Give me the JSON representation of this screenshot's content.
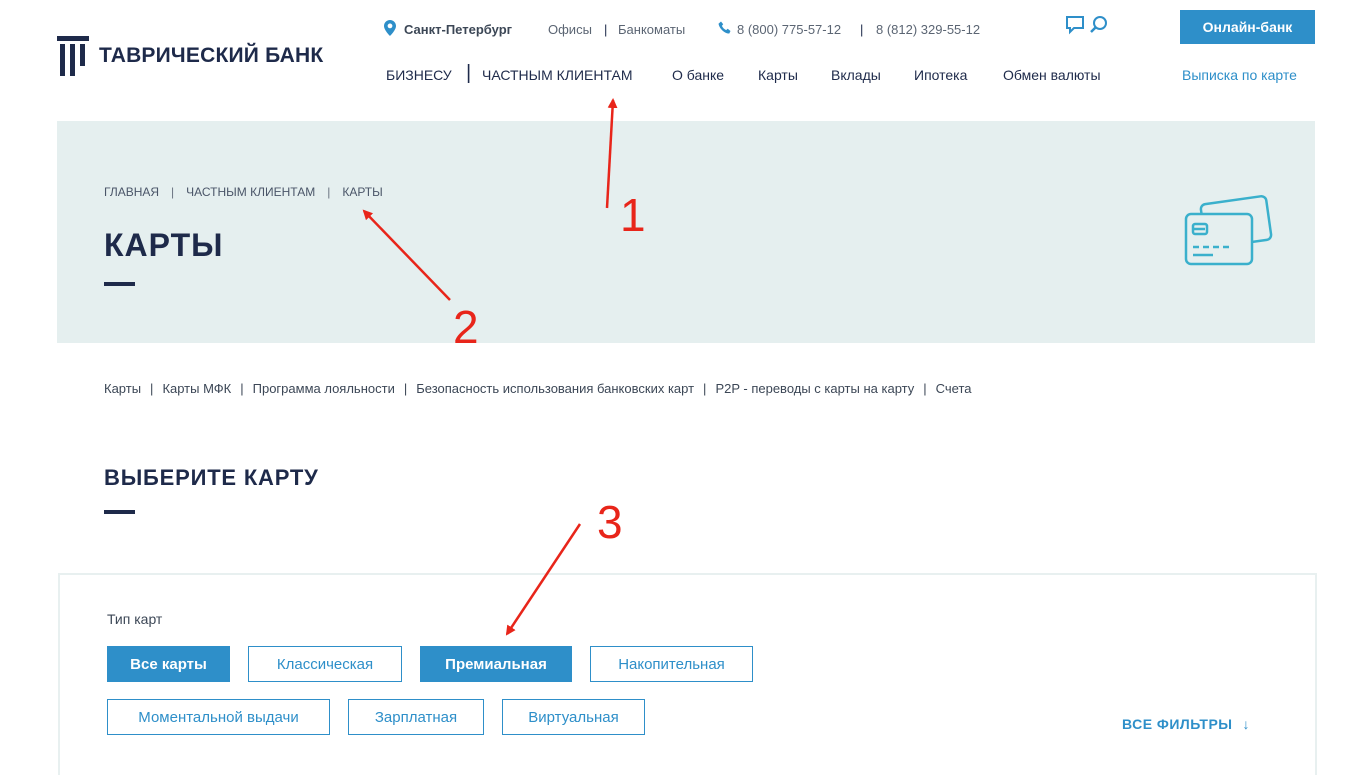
{
  "header": {
    "logo_text": "ТАВРИЧЕСКИЙ БАНК",
    "city": "Санкт-Петербург",
    "offices": "Офисы",
    "atms": "Банкоматы",
    "phone1": "8 (800) 775-57-12",
    "phone2": "8 (812) 329-55-12",
    "separator": "|",
    "online_bank": "Онлайн-банк",
    "icons": [
      "location-pin-icon",
      "phone-icon",
      "chat-icon",
      "search-icon"
    ]
  },
  "nav": {
    "business": "БИЗНЕСУ",
    "private": "ЧАСТНЫМ КЛИЕНТАМ",
    "items": [
      "О банке",
      "Карты",
      "Вклады",
      "Ипотека",
      "Обмен валюты"
    ],
    "statement": "Выписка по карте"
  },
  "banner": {
    "breadcrumbs": [
      "ГЛАВНАЯ",
      "ЧАСТНЫМ КЛИЕНТАМ",
      "КАРТЫ"
    ],
    "title": "КАРТЫ",
    "icon": "credit-cards-icon"
  },
  "subnav": [
    "Карты",
    "Карты МФК",
    "Программа лояльности",
    "Безопасность использования банковских карт",
    "P2P - переводы с карты на карту",
    "Счета"
  ],
  "select": {
    "title": "ВЫБЕРИТЕ КАРТУ",
    "filter_label": "Тип карт",
    "chips": [
      {
        "label": "Все карты",
        "active": true
      },
      {
        "label": "Классическая",
        "active": false
      },
      {
        "label": "Премиальная",
        "active": true
      },
      {
        "label": "Накопительная",
        "active": false
      },
      {
        "label": "Моментальной выдачи",
        "active": false
      },
      {
        "label": "Зарплатная",
        "active": false
      },
      {
        "label": "Виртуальная",
        "active": false
      }
    ],
    "all_filters": "ВСЕ ФИЛЬТРЫ",
    "all_filters_arrow": "↓"
  },
  "annotations": {
    "color": "#e8251a",
    "numbers": [
      "1",
      "2",
      "3"
    ]
  },
  "colors": {
    "accent": "#2e8fc9",
    "navy": "#1e2a4a",
    "banner_bg": "#e5efef"
  }
}
